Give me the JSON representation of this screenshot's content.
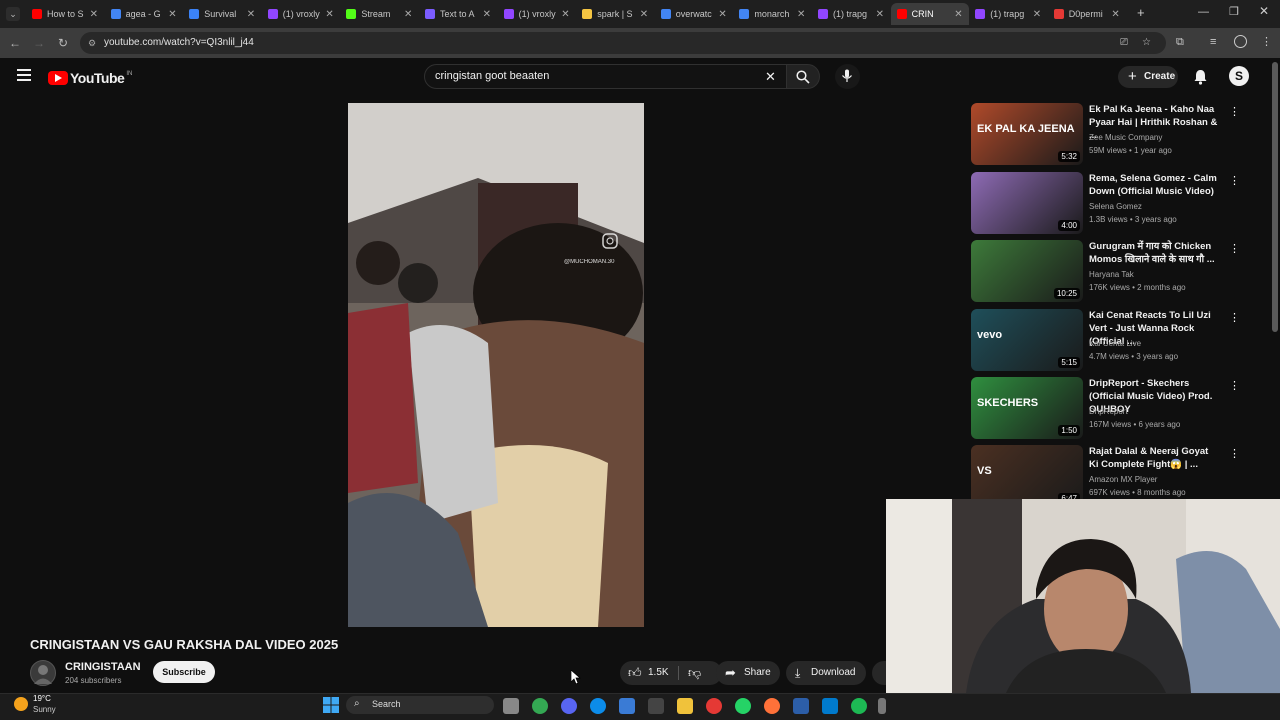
{
  "browser": {
    "tabs": [
      {
        "title": "How to S",
        "color": "#ff0000"
      },
      {
        "title": "agea - G",
        "color": "#4285f4"
      },
      {
        "title": "Survival",
        "color": "#3b82f6"
      },
      {
        "title": "(1) vroxly",
        "color": "#9146ff"
      },
      {
        "title": "Stream",
        "color": "#53fc18"
      },
      {
        "title": "Text to A",
        "color": "#7b5cff"
      },
      {
        "title": "(1) vroxly",
        "color": "#9146ff"
      },
      {
        "title": "spark | S",
        "color": "#f5c542"
      },
      {
        "title": "overwatc",
        "color": "#4285f4"
      },
      {
        "title": "monarch",
        "color": "#4285f4"
      },
      {
        "title": "(1) trapg",
        "color": "#9146ff"
      },
      {
        "title": "CRIN",
        "color": "#ff0000"
      },
      {
        "title": "(1) trapg",
        "color": "#9146ff"
      },
      {
        "title": "D0permi",
        "color": "#e53935"
      }
    ],
    "url": "youtube.com/watch?v=QI3nlil_j44"
  },
  "youtube": {
    "logo_text": "YouTube",
    "country_code": "IN",
    "search_query": "cringistan goot beaaten",
    "create_label": "Create",
    "avatar_letter": "S"
  },
  "video": {
    "watermark": "@MUCHOMAN.30",
    "title": "CRINGISTAAN VS GAU RAKSHA DAL VIDEO 2025",
    "channel_name": "CRINGISTAAN",
    "subscribers": "204 subscribers",
    "subscribe_label": "Subscribe",
    "likes": "1.5K",
    "share_label": "Share",
    "download_label": "Download"
  },
  "recommendations": [
    {
      "title": "Ek Pal Ka Jeena - Kaho Naa Pyaar Hai | Hrithik Roshan & ...",
      "channel": "Zee Music Company",
      "meta": "59M views • 1 year ago",
      "duration": "5:32",
      "thumb_color": "#b04a2a",
      "thumb_text": "EK PAL KA JEENA"
    },
    {
      "title": "Rema, Selena Gomez - Calm Down (Official Music Video)",
      "channel": "Selena Gomez",
      "meta": "1.3B views • 3 years ago",
      "duration": "4:00",
      "thumb_color": "#8e6bb5",
      "thumb_text": ""
    },
    {
      "title": "Gurugram में गाय को Chicken Momos खिलाने वाले के साथ गौ ...",
      "channel": "Haryana Tak",
      "meta": "176K views • 2 months ago",
      "duration": "10:25",
      "thumb_color": "#3d7a3a",
      "thumb_text": ""
    },
    {
      "title": "Kai Cenat Reacts To Lil Uzi Vert - Just Wanna Rock (Official ...",
      "channel": "Kai Cenat Live",
      "meta": "4.7M views • 3 years ago",
      "duration": "5:15",
      "thumb_color": "#1f4f5a",
      "thumb_text": "vevo"
    },
    {
      "title": "DripReport - Skechers (Official Music Video) Prod. OUHBOY",
      "channel": "DripReport",
      "meta": "167M views • 6 years ago",
      "duration": "1:50",
      "thumb_color": "#2f8f3f",
      "thumb_text": "SKECHERS"
    },
    {
      "title": "Rajat Dalal & Neeraj Goyat Ki Complete Fight😱 | ...",
      "channel": "Amazon MX Player",
      "meta": "697K views • 8 months ago",
      "duration": "6:47",
      "thumb_color": "#4b3022",
      "thumb_text": "VS"
    }
  ],
  "taskbar": {
    "weather_temp": "19°C",
    "weather_desc": "Sunny",
    "search_label": "Search"
  }
}
